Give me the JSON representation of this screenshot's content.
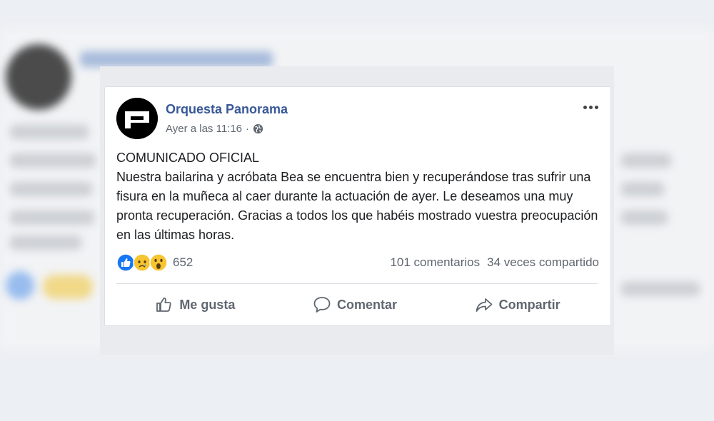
{
  "post": {
    "page_name": "Orquesta Panorama",
    "timestamp": "Ayer a las 11:16",
    "separator": "·",
    "body": {
      "heading": "COMUNICADO OFICIAL",
      "text": "Nuestra bailarina y acróbata Bea se encuentra bien y recuperándose tras sufrir una fisura en la muñeca al caer durante la actuación de ayer. Le deseamos una muy pronta recuperación. Gracias a todos los que habéis mostrado vuestra preocupación en las últimas horas."
    },
    "reactions": {
      "types": [
        "like-icon",
        "sad-icon",
        "wow-icon"
      ],
      "count": "652"
    },
    "stats": {
      "comments": "101 comentarios",
      "shares": "34 veces compartido"
    },
    "actions": {
      "like": "Me gusta",
      "comment": "Comentar",
      "share": "Compartir"
    }
  },
  "colors": {
    "name_blue": "#385898",
    "meta_gray": "#606770",
    "like_blue": "#1877f2",
    "emoji_yellow": "#f7c531"
  }
}
